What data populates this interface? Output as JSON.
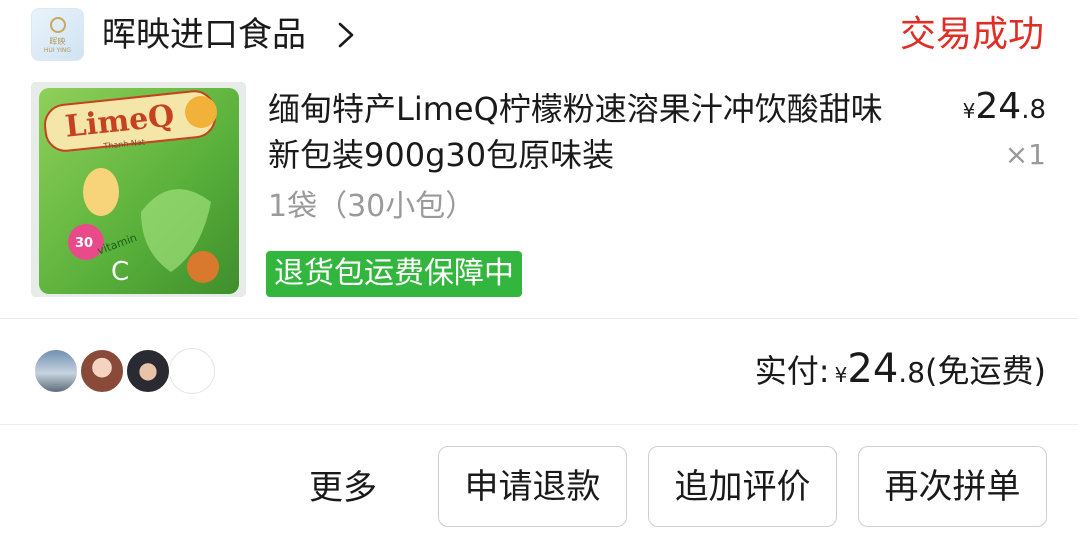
{
  "store": {
    "logo_text_top": "晖映",
    "logo_text_bottom": "HUI YING",
    "name": "晖映进口食品",
    "chevron_icon": "chevron-right-icon"
  },
  "order": {
    "status": "交易成功",
    "status_color": "#e02e24"
  },
  "product": {
    "title": "缅甸特产LimeQ柠檬粉速溶果汁冲饮酸甜味新包装900g30包原味装",
    "spec": "1袋（30小包）",
    "price_currency": "¥",
    "price_integer": "24",
    "price_decimal": ".8",
    "quantity": "×1",
    "badge": "退货包运费保障中",
    "badge_color": "#33b63d",
    "image": {
      "brand": "LimeQ",
      "sub": "Thanh Nat",
      "vitamin": "vitamin",
      "vitamin_letter": "C",
      "count": "30"
    }
  },
  "payment": {
    "label": "实付:",
    "currency": "¥",
    "amount_integer": "24",
    "amount_decimal": ".8",
    "note": "(免运费)"
  },
  "avatars": [
    "avatar-landscape",
    "avatar-girl",
    "avatar-boy",
    "avatar-empty"
  ],
  "actions": {
    "more": "更多",
    "refund": "申请退款",
    "add_review": "追加评价",
    "group_again": "再次拼单"
  }
}
